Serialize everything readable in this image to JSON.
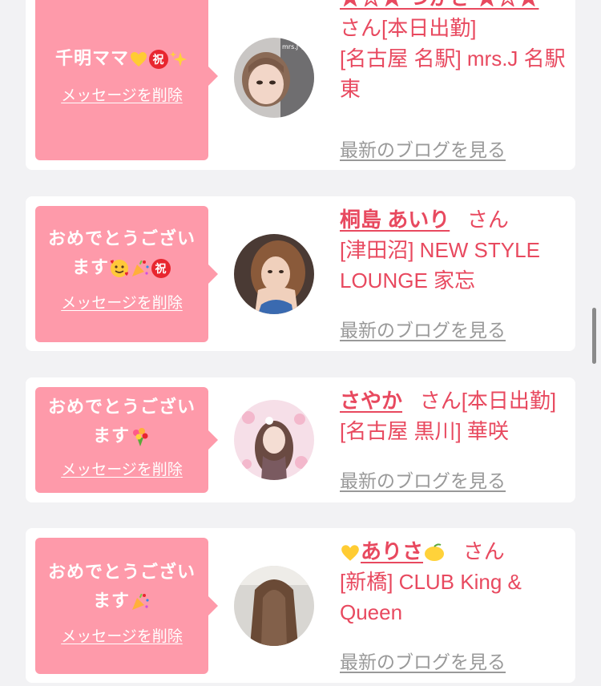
{
  "cards": [
    {
      "message_text": "千明ママ",
      "delete_label": "メッセージを削除",
      "name": "★☆★ つかさ ★☆★",
      "honorific": "さん",
      "status": "[本日出勤]",
      "shop": "[名古屋 名駅] mrs.J 名駅東",
      "blog_label": "最新のブログを見る",
      "avatar_text": "mrs.J 名駅 つかさ"
    },
    {
      "message_text": "おめでとうございます",
      "delete_label": "メッセージを削除",
      "name": "桐島 あいり",
      "honorific": "さん",
      "status": "",
      "shop": "[津田沼] NEW STYLE LOUNGE 家忘",
      "blog_label": "最新のブログを見る"
    },
    {
      "message_text": "おめでとうございます",
      "delete_label": "メッセージを削除",
      "name": "さやか",
      "honorific": "さん",
      "status": "[本日出勤]",
      "shop": "[名古屋 黒川] 華咲",
      "blog_label": "最新のブログを見る"
    },
    {
      "message_text": "おめでとうございます",
      "delete_label": "メッセージを削除",
      "name": "ありさ",
      "honorific": "さん",
      "status": "",
      "shop": "[新橋] CLUB King & Queen",
      "blog_label": "最新のブログを見る"
    }
  ],
  "icons": {
    "celebrate": "祝",
    "heart": "yellow-heart-icon",
    "sparkles": "sparkles-icon",
    "party": "party-popper-icon",
    "smiling_hearts": "smiling-face-with-hearts-icon",
    "bouquet": "bouquet-icon",
    "lemon": "lemon-icon"
  },
  "colors": {
    "bubble": "#fe9aaa",
    "name": "#e8495f",
    "link_gray": "#999999",
    "background": "#f2f2f4"
  }
}
